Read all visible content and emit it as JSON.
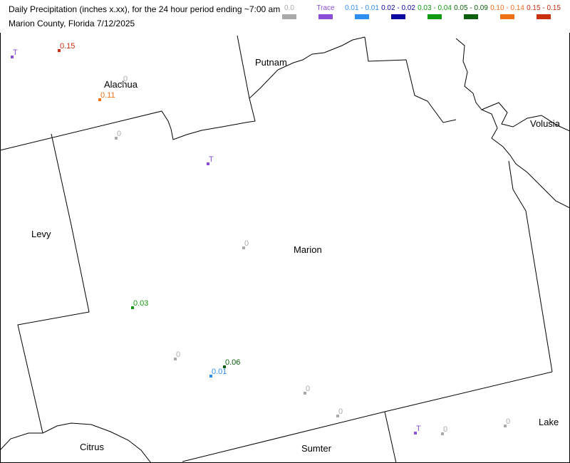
{
  "title": {
    "line1": "Daily Precipitation (inches  x.xx),  for the 24 hour period ending ~7:00 am",
    "line2": "Marion County, Florida  7/12/2025"
  },
  "legend": [
    {
      "label": "0.0",
      "color": "#a9a9a9"
    },
    {
      "label": "Trace",
      "color": "#8a4fd6"
    },
    {
      "label": "0.01 - 0.01",
      "color": "#2f8ff0"
    },
    {
      "label": "0.02 - 0.02",
      "color": "#0a0aa0"
    },
    {
      "label": "0.03 - 0.04",
      "color": "#119a11"
    },
    {
      "label": "0.05 - 0.09",
      "color": "#0b5e0b"
    },
    {
      "label": "0.10 - 0.14",
      "color": "#f07018"
    },
    {
      "label": "0.15 - 0.15",
      "color": "#c83010"
    }
  ],
  "counties": [
    "Putnam",
    "Alachua",
    "Volusia",
    "Levy",
    "Marion",
    "Citrus",
    "Sumter",
    "Lake"
  ],
  "stations": [
    {
      "value": "T",
      "category": "Trace"
    },
    {
      "value": "0.15",
      "category": "0.15 - 0.15"
    },
    {
      "value": "0",
      "category": "0.0"
    },
    {
      "value": "0.11",
      "category": "0.10 - 0.14"
    },
    {
      "value": "0",
      "category": "0.0"
    },
    {
      "value": "T",
      "category": "Trace"
    },
    {
      "value": "0",
      "category": "0.0"
    },
    {
      "value": "0.03",
      "category": "0.03 - 0.04"
    },
    {
      "value": "0",
      "category": "0.0"
    },
    {
      "value": "0.06",
      "category": "0.05 - 0.09"
    },
    {
      "value": "0.01",
      "category": "0.01 - 0.01"
    },
    {
      "value": "0",
      "category": "0.0"
    },
    {
      "value": "0",
      "category": "0.0"
    },
    {
      "value": "T",
      "category": "Trace"
    },
    {
      "value": "0",
      "category": "0.0"
    },
    {
      "value": "0",
      "category": "0.0"
    }
  ]
}
